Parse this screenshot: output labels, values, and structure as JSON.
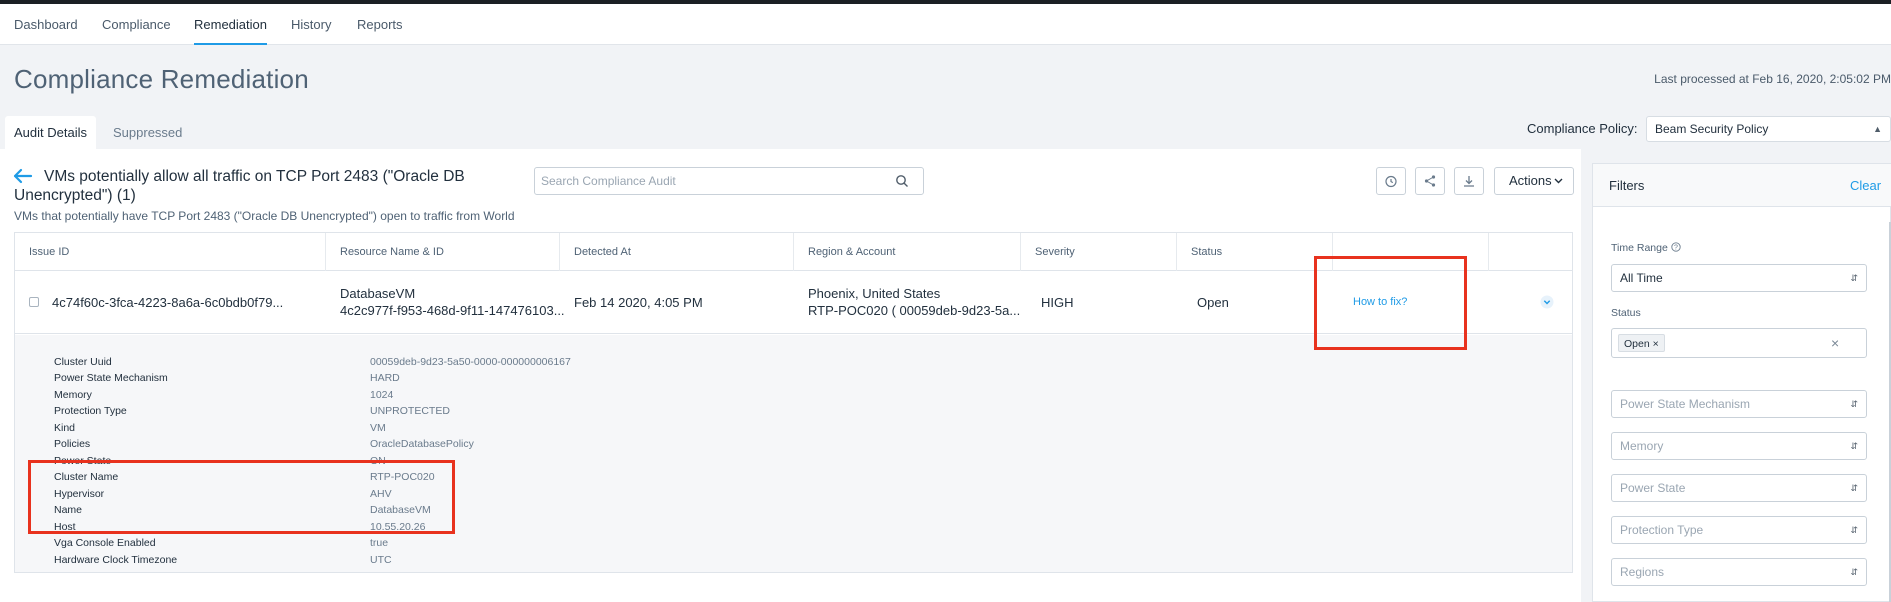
{
  "nav": {
    "tabs": [
      {
        "label": "Dashboard"
      },
      {
        "label": "Compliance"
      },
      {
        "label": "Remediation",
        "active": true
      },
      {
        "label": "History"
      },
      {
        "label": "Reports"
      }
    ]
  },
  "page": {
    "title": "Compliance Remediation",
    "last_processed": "Last processed at Feb 16, 2020, 2:05:02 PM"
  },
  "subtabs": [
    {
      "label": "Audit Details",
      "active": true
    },
    {
      "label": "Suppressed"
    }
  ],
  "policy": {
    "label": "Compliance Policy:",
    "value": "Beam Security Policy"
  },
  "issue": {
    "title": "VMs potentially allow all traffic on TCP Port 2483 (\"Oracle DB Unencrypted\") (1)",
    "description": "VMs that potentially have TCP Port 2483 (\"Oracle DB Unencrypted\") open to traffic from World"
  },
  "search": {
    "placeholder": "Search Compliance Audit"
  },
  "toolbar": {
    "actions_label": "Actions",
    "icons": [
      "alarm-clock-icon",
      "share-icon",
      "download-icon"
    ]
  },
  "table": {
    "columns": [
      "Issue ID",
      "Resource Name & ID",
      "Detected At",
      "Region & Account",
      "Severity",
      "Status"
    ],
    "row": {
      "issue_id": "4c74f60c-3fca-4223-8a6a-6c0bdb0f79...",
      "resource_name": "DatabaseVM",
      "resource_id": "4c2c977f-f953-468d-9f11-147476103...",
      "detected_at": "Feb 14 2020, 4:05 PM",
      "region": "Phoenix, United States",
      "account": "RTP-POC020 ( 00059deb-9d23-5a...",
      "severity": "HIGH",
      "status": "Open",
      "how_to_fix": "How to fix?"
    },
    "details": [
      {
        "key": "Cluster Uuid",
        "value": "00059deb-9d23-5a50-0000-000000006167"
      },
      {
        "key": "Power State Mechanism",
        "value": "HARD"
      },
      {
        "key": "Memory",
        "value": "1024"
      },
      {
        "key": "Protection Type",
        "value": "UNPROTECTED"
      },
      {
        "key": "Kind",
        "value": "VM"
      },
      {
        "key": "Policies",
        "value": "OracleDatabasePolicy"
      },
      {
        "key": "Power State",
        "value": "ON"
      },
      {
        "key": "Cluster Name",
        "value": "RTP-POC020"
      },
      {
        "key": "Hypervisor",
        "value": "AHV"
      },
      {
        "key": "Name",
        "value": "DatabaseVM"
      },
      {
        "key": "Host",
        "value": "10.55.20.26"
      },
      {
        "key": "Vga Console Enabled",
        "value": "true"
      },
      {
        "key": "Hardware Clock Timezone",
        "value": "UTC"
      }
    ]
  },
  "filters": {
    "title": "Filters",
    "clear": "Clear",
    "time_range_label": "Time Range",
    "time_range_value": "All Time",
    "status_label": "Status",
    "status_chip": "Open",
    "placeholders": [
      "Power State Mechanism",
      "Memory",
      "Power State",
      "Protection Type",
      "Regions"
    ]
  },
  "colors": {
    "accent": "#1f9be6",
    "highlight": "#e8321e"
  }
}
